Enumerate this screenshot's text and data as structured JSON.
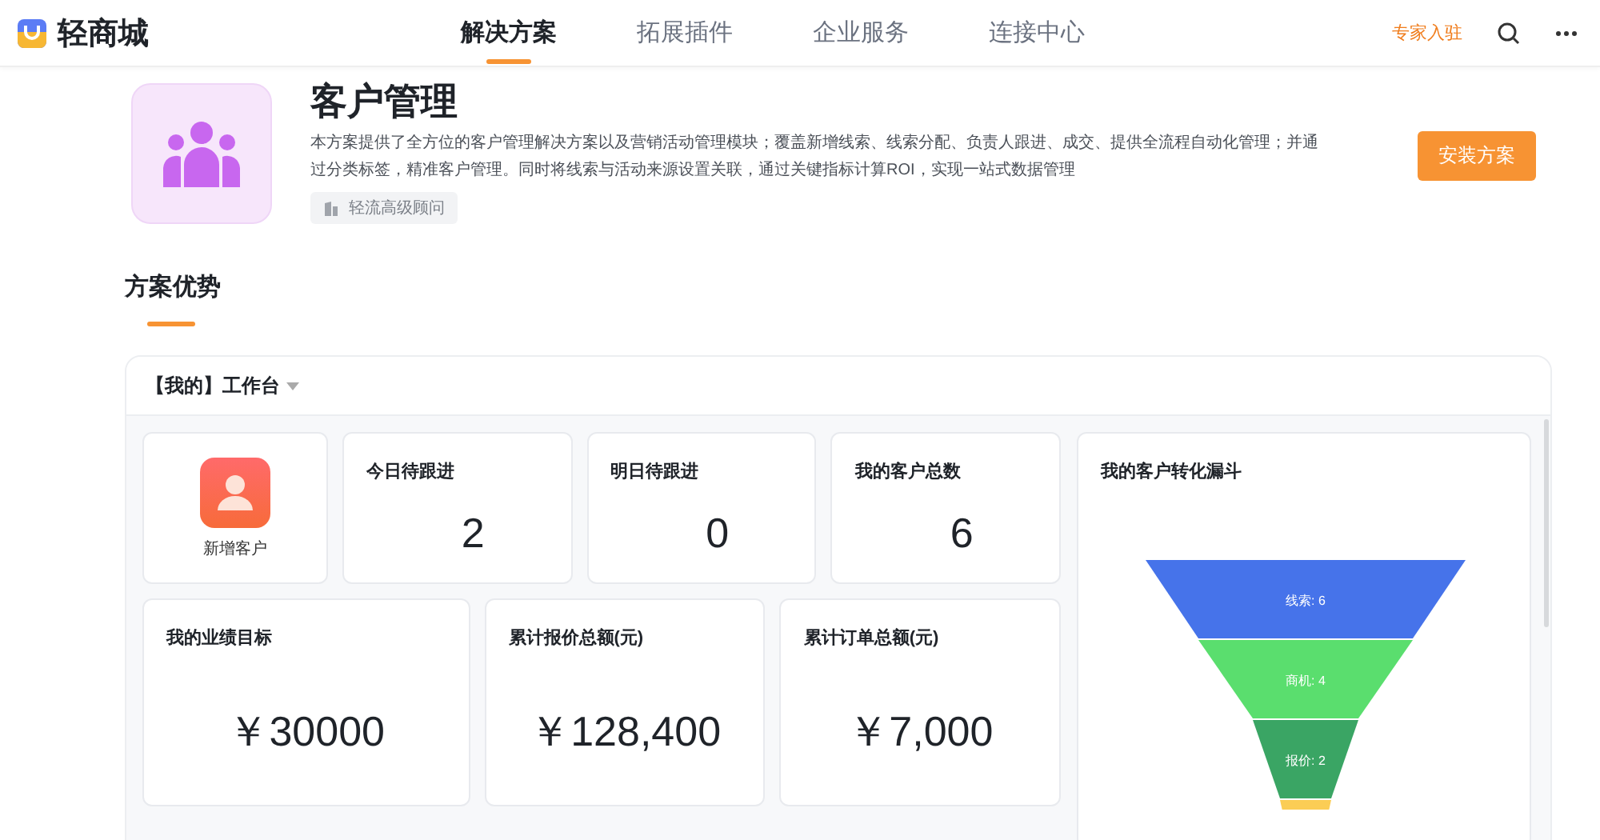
{
  "brand": {
    "name": "轻商城"
  },
  "nav": [
    {
      "label": "解决方案",
      "selected": true
    },
    {
      "label": "拓展插件",
      "selected": false
    },
    {
      "label": "企业服务",
      "selected": false
    },
    {
      "label": "连接中心",
      "selected": false
    }
  ],
  "header_link": "专家入驻",
  "hero": {
    "title": "客户管理",
    "description": "本方案提供了全方位的客户管理解决方案以及营销活动管理模块；覆盖新增线索、线索分配、负责人跟进、成交、提供全流程自动化管理；并通过分类标签，精准客户管理。同时将线索与活动来源设置关联，通过关键指标计算ROI，实现一站式数据管理",
    "tag": "轻流高级顾问",
    "install_button": "安装方案"
  },
  "section_title": "方案优势",
  "workspace": {
    "title": "【我的】工作台",
    "quick_action": {
      "label": "新增客户"
    },
    "stats": [
      {
        "label": "今日待跟进",
        "value": "2"
      },
      {
        "label": "明日待跟进",
        "value": "0"
      },
      {
        "label": "我的客户总数",
        "value": "6"
      }
    ],
    "amounts": [
      {
        "label": "我的业绩目标",
        "value": "￥30000"
      },
      {
        "label": "累计报价总额(元)",
        "value": "￥128,400"
      },
      {
        "label": "累计订单总额(元)",
        "value": "￥7,000"
      }
    ],
    "funnel": {
      "title": "我的客户转化漏斗",
      "stages": [
        {
          "label": "线索: 6",
          "color": "#4673ea"
        },
        {
          "label": "商机: 4",
          "color": "#5ade6e"
        },
        {
          "label": "报价: 2",
          "color": "#3aa564"
        },
        {
          "color": "#fbcd55"
        }
      ]
    }
  }
}
